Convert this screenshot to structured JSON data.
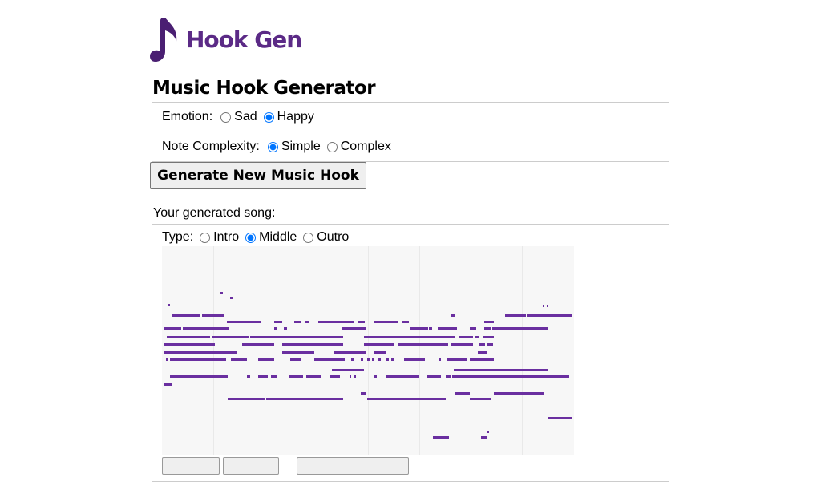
{
  "logo": {
    "text": "Hook Gen",
    "color": "#5b2a86"
  },
  "page_title": "Music Hook Generator",
  "emotion": {
    "label": "Emotion:",
    "options": [
      "Sad",
      "Happy"
    ],
    "selected": "Happy"
  },
  "complexity": {
    "label": "Note Complexity:",
    "options": [
      "Simple",
      "Complex"
    ],
    "selected": "Simple"
  },
  "generate_button": "Generate New Music Hook",
  "song_label": "Your generated song:",
  "song_type": {
    "label": "Type:",
    "options": [
      "Intro",
      "Middle",
      "Outro"
    ],
    "selected": "Middle"
  },
  "piano_roll": {
    "note_color": "#6a2fa0",
    "background": "#f7f7f7"
  }
}
